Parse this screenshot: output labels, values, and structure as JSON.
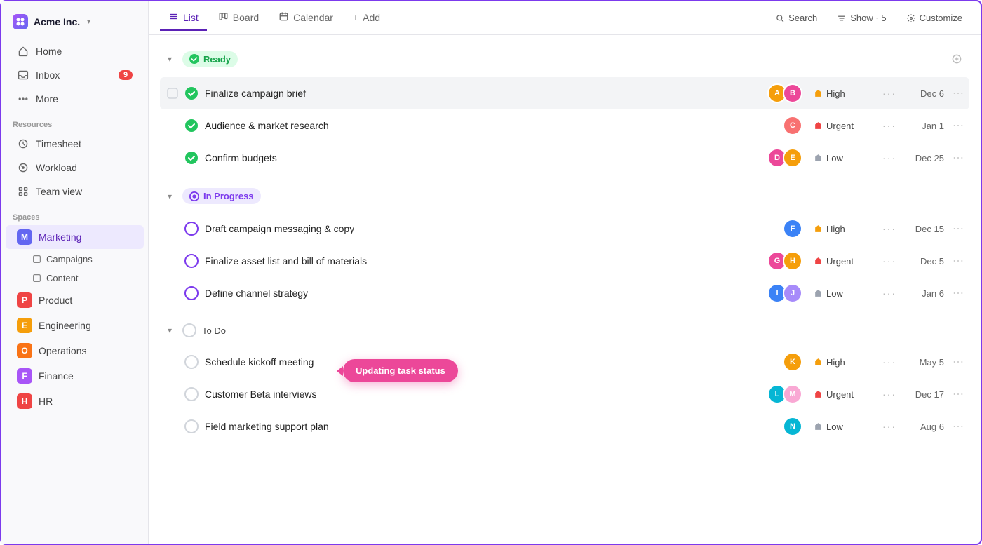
{
  "app": {
    "name": "Acme Inc.",
    "logo_label": "Acme Inc."
  },
  "sidebar": {
    "nav_items": [
      {
        "id": "home",
        "label": "Home",
        "icon": "home"
      },
      {
        "id": "inbox",
        "label": "Inbox",
        "icon": "inbox",
        "badge": "9"
      },
      {
        "id": "more",
        "label": "More",
        "icon": "more"
      }
    ],
    "resources_title": "Resources",
    "resources": [
      {
        "id": "timesheet",
        "label": "Timesheet",
        "icon": "clock"
      },
      {
        "id": "workload",
        "label": "Workload",
        "icon": "workload"
      },
      {
        "id": "teamview",
        "label": "Team view",
        "icon": "grid"
      }
    ],
    "spaces_title": "Spaces",
    "spaces": [
      {
        "id": "marketing",
        "label": "Marketing",
        "color": "#6366f1",
        "letter": "M",
        "active": true
      },
      {
        "id": "product",
        "label": "Product",
        "color": "#ef4444",
        "letter": "P"
      },
      {
        "id": "engineering",
        "label": "Engineering",
        "color": "#f59e0b",
        "letter": "E"
      },
      {
        "id": "operations",
        "label": "Operations",
        "color": "#f97316",
        "letter": "O"
      },
      {
        "id": "finance",
        "label": "Finance",
        "color": "#a855f7",
        "letter": "F"
      },
      {
        "id": "hr",
        "label": "HR",
        "color": "#ef4444",
        "letter": "H"
      }
    ],
    "sub_items": [
      {
        "id": "campaigns",
        "label": "Campaigns"
      },
      {
        "id": "content",
        "label": "Content"
      }
    ]
  },
  "toolbar": {
    "tabs": [
      {
        "id": "list",
        "label": "List",
        "icon": "list",
        "active": true
      },
      {
        "id": "board",
        "label": "Board",
        "icon": "board"
      },
      {
        "id": "calendar",
        "label": "Calendar",
        "icon": "calendar"
      },
      {
        "id": "add",
        "label": "Add",
        "icon": "plus"
      }
    ],
    "search_label": "Search",
    "show_label": "Show · 5",
    "customize_label": "Customize"
  },
  "sections": [
    {
      "id": "ready",
      "label": "Ready",
      "type": "ready",
      "tasks": [
        {
          "id": "t1",
          "name": "Finalize campaign brief",
          "status": "done",
          "priority": "High",
          "priority_type": "high",
          "date": "Dec 6",
          "avatars": [
            "#f59e0b",
            "#ec4899"
          ],
          "has_checkbox": true,
          "highlighted": true
        },
        {
          "id": "t2",
          "name": "Audience & market research",
          "status": "done",
          "priority": "Urgent",
          "priority_type": "urgent",
          "date": "Jan 1",
          "avatars": [
            "#f87171"
          ]
        },
        {
          "id": "t3",
          "name": "Confirm budgets",
          "status": "done",
          "priority": "Low",
          "priority_type": "low",
          "date": "Dec 25",
          "avatars": [
            "#ec4899",
            "#f59e0b"
          ]
        }
      ]
    },
    {
      "id": "in-progress",
      "label": "In Progress",
      "type": "in-progress",
      "tasks": [
        {
          "id": "t4",
          "name": "Draft campaign messaging & copy",
          "status": "in-progress",
          "priority": "High",
          "priority_type": "high",
          "date": "Dec 15",
          "avatars": [
            "#3b82f6"
          ]
        },
        {
          "id": "t5",
          "name": "Finalize asset list and bill of materials",
          "status": "in-progress",
          "priority": "Urgent",
          "priority_type": "urgent",
          "date": "Dec 5",
          "avatars": [
            "#ec4899",
            "#f59e0b"
          ]
        },
        {
          "id": "t6",
          "name": "Define channel strategy",
          "status": "in-progress",
          "priority": "Low",
          "priority_type": "low",
          "date": "Jan 6",
          "avatars": [
            "#3b82f6",
            "#a78bfa"
          ]
        }
      ]
    },
    {
      "id": "todo",
      "label": "To Do",
      "type": "todo",
      "tasks": [
        {
          "id": "t7",
          "name": "Schedule kickoff meeting",
          "status": "todo",
          "priority": "High",
          "priority_type": "high",
          "date": "May 5",
          "avatars": [
            "#f59e0b"
          ]
        },
        {
          "id": "t8",
          "name": "Customer Beta interviews",
          "status": "todo",
          "priority": "Urgent",
          "priority_type": "urgent",
          "date": "Dec 17",
          "avatars": [
            "#06b6d4",
            "#f9a8d4"
          ]
        },
        {
          "id": "t9",
          "name": "Field marketing support plan",
          "status": "todo",
          "priority": "Low",
          "priority_type": "low",
          "date": "Aug 6",
          "avatars": [
            "#06b6d4"
          ]
        }
      ]
    }
  ],
  "tooltip": {
    "label": "Updating task status"
  }
}
